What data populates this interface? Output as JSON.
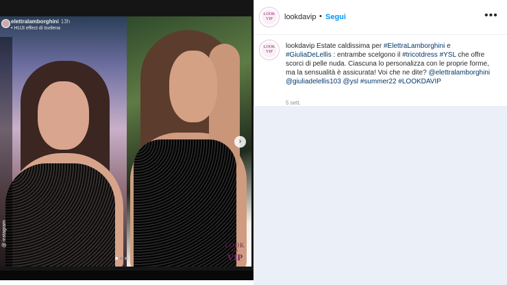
{
  "story": {
    "username": "elettralamborghini",
    "time": "13h",
    "effect": "• HUJI effect di tsvilena",
    "watermark": "@ instagram"
  },
  "post": {
    "header": {
      "username": "lookdavip",
      "separator": "•",
      "follow_label": "Segui",
      "more_icon": "more-horizontal-icon"
    },
    "caption": {
      "username": "lookdavip",
      "segments": {
        "t1": "Estate caldissima per ",
        "h1": "#ElettraLamborghini",
        "t2": " e ",
        "h2": "#GiuliaDeLellis",
        "t3": " : entrambe scelgono il ",
        "h3": "#tricotdress",
        "t4": " ",
        "h4": "#YSL",
        "t5": " che offre scorci di pelle nuda. Ciascuna lo personalizza con le proprie forme, ma la sensualità è assicurata! Voi che ne dite? ",
        "m1": "@elettralamborghini",
        "t6": " ",
        "m2": "@giuliadelellis103",
        "t7": " ",
        "m3": "@ysl",
        "t8": " ",
        "h5": "#summer22",
        "t9": " ",
        "h6": "#LOOKDAVIP"
      },
      "time": "5 sett."
    },
    "brand_logo": {
      "line1": "LOOK",
      "line2": "DA",
      "line3": "VIP"
    },
    "carousel": {
      "next_icon": "chevron-right-icon",
      "next_glyph": "›",
      "count": 3,
      "active_index": 0
    }
  },
  "colors": {
    "link": "#00376b",
    "follow": "#0095f6",
    "panel_background": "#ebeff8",
    "brand": "#7a1f5a"
  }
}
